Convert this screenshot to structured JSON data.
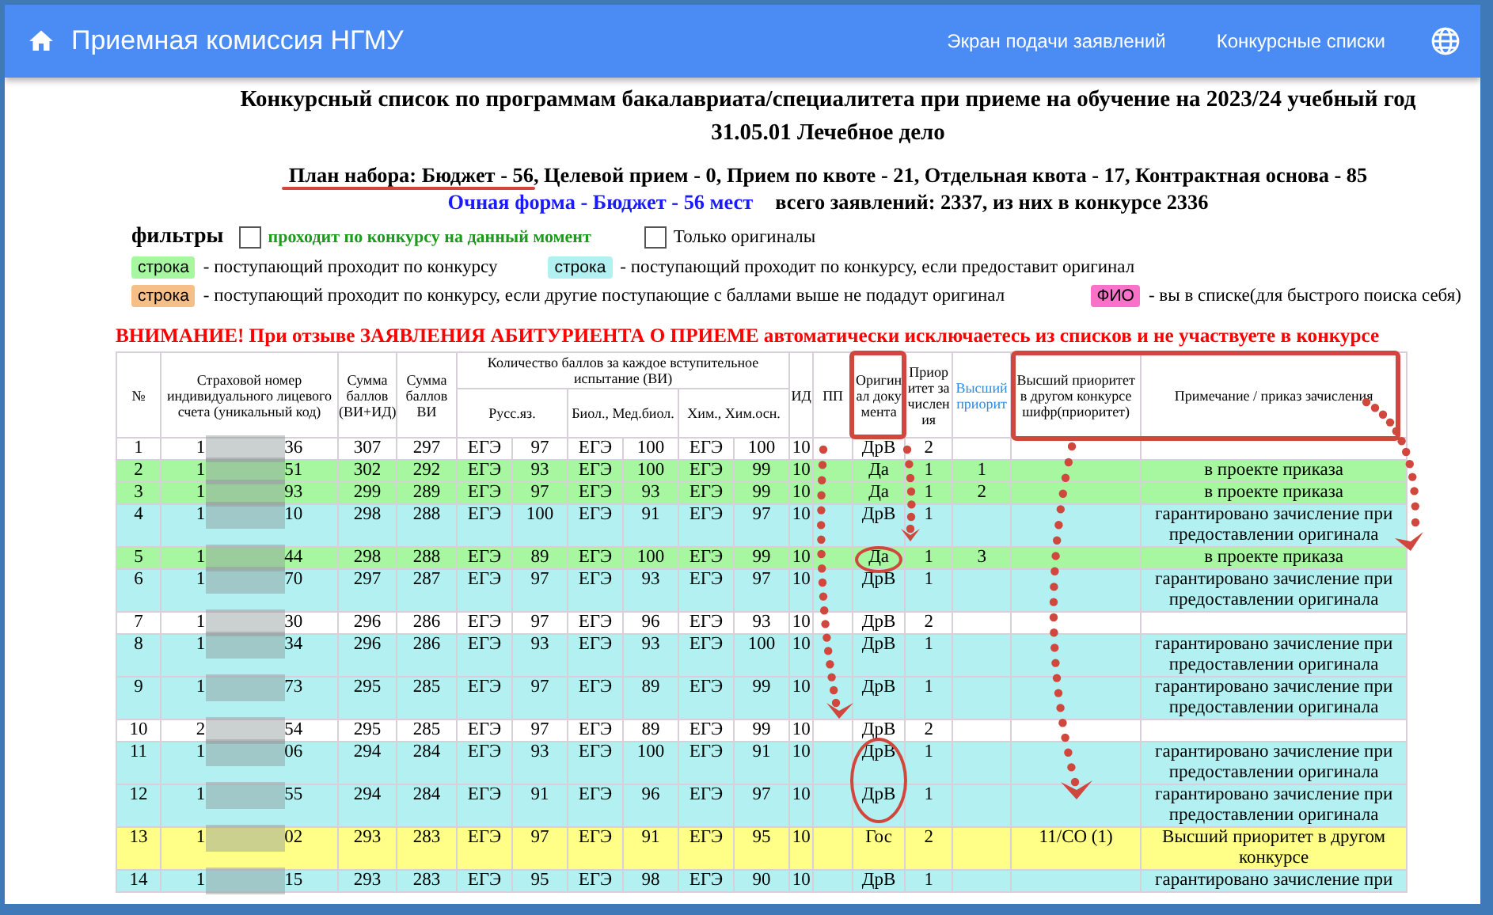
{
  "app_bar": {
    "title": "Приемная комиссия НГМУ",
    "links": [
      "Экран подачи заявлений",
      "Конкурсные списки"
    ]
  },
  "heading": {
    "title": "Конкурсный список по программам бакалавриата/специалитета при приеме на обучение на 2023/24 учебный год",
    "program": "31.05.01 Лечебное дело",
    "plan": "План набора: Бюджет - 56, Целевой прием - 0, Прием по квоте - 21, Отдельная квота - 17, Контрактная основа - 85",
    "form": "Очная форма - Бюджет - 56 мест",
    "totals": "всего заявлений:  2337, из них в конкурсе 2336"
  },
  "filters": {
    "label": "фильтры",
    "options": [
      {
        "label": "проходит по конкурсу на данный момент",
        "checked": false,
        "kind": "highlight"
      },
      {
        "label": "Только оригиналы",
        "checked": false,
        "kind": "plain"
      }
    ]
  },
  "legend": [
    [
      {
        "swatch": "строка",
        "color": "#a6f7a0",
        "text": "- поступающий проходит по конкурсу"
      },
      {
        "swatch": "строка",
        "color": "#b2f0f2",
        "text": "- поступающий проходит по конкурсу, если предоставит оригинал"
      }
    ],
    [
      {
        "swatch": "строка",
        "color": "#f7bf88",
        "text": "- поступающий проходит по конкурсу, если другие поступающие с баллами выше не подадут оригинал"
      },
      {
        "swatch": "ФИО",
        "color": "#f772c8",
        "text": "- вы в списке(для быстрого поиска себя)"
      }
    ]
  ],
  "warning": "ВНИМАНИЕ! При отзыве ЗАЯВЛЕНИЯ АБИТУРИЕНТА О ПРИЕМЕ автоматически исключаетесь из списков и не участвуете в конкурсе",
  "table": {
    "columns": {
      "no": "№",
      "snils": "Страховой номер индивидуального лицевого счета (уникальный код)",
      "sum_total": "Сумма баллов (ВИ+ИД)",
      "sum_vi": "Сумма баллов ВИ",
      "exams": "Количество баллов за каждое вступительное испытание (ВИ)",
      "subjects": [
        "Русс.яз.",
        "Биол., Мед.биол.",
        "Хим., Хим.осн."
      ],
      "id_points": "ИД",
      "pp": "ПП",
      "original": "Оригинал документа",
      "priority": "Приоритет зачисления",
      "top_priority": "Высший приорит",
      "other_contest": "Высший приоритет в другом конкурсе шифр(приоритет)",
      "note": "Примечание / приказ зачисления"
    },
    "rows": [
      {
        "no": "1",
        "snils_start": "1",
        "snils_end": "36",
        "sum_total": "307",
        "sum_vi": "297",
        "scores": [
          {
            "type": "ЕГЭ",
            "score": "97"
          },
          {
            "type": "ЕГЭ",
            "score": "100"
          },
          {
            "type": "ЕГЭ",
            "score": "100"
          }
        ],
        "id_points": "10",
        "original": "ДрВ",
        "priority": "2",
        "color": "#ffffff"
      },
      {
        "no": "2",
        "snils_start": "1",
        "snils_end": "51",
        "sum_total": "302",
        "sum_vi": "292",
        "scores": [
          {
            "type": "ЕГЭ",
            "score": "93"
          },
          {
            "type": "ЕГЭ",
            "score": "100"
          },
          {
            "type": "ЕГЭ",
            "score": "99"
          }
        ],
        "id_points": "10",
        "original": "Да",
        "priority": "1",
        "top_priority": "1",
        "note": "в проекте приказа",
        "color": "#a6f7a0"
      },
      {
        "no": "3",
        "snils_start": "1",
        "snils_end": "93",
        "sum_total": "299",
        "sum_vi": "289",
        "scores": [
          {
            "type": "ЕГЭ",
            "score": "97"
          },
          {
            "type": "ЕГЭ",
            "score": "93"
          },
          {
            "type": "ЕГЭ",
            "score": "99"
          }
        ],
        "id_points": "10",
        "original": "Да",
        "priority": "1",
        "top_priority": "2",
        "note": "в проекте приказа",
        "color": "#a6f7a0"
      },
      {
        "no": "4",
        "snils_start": "1",
        "snils_end": "10",
        "sum_total": "298",
        "sum_vi": "288",
        "scores": [
          {
            "type": "ЕГЭ",
            "score": "100"
          },
          {
            "type": "ЕГЭ",
            "score": "91"
          },
          {
            "type": "ЕГЭ",
            "score": "97"
          }
        ],
        "id_points": "10",
        "original": "ДрВ",
        "priority": "1",
        "note": "гарантировано зачисление при предоставлении оригинала",
        "color": "#b2f0f2"
      },
      {
        "no": "5",
        "snils_start": "1",
        "snils_end": "44",
        "sum_total": "298",
        "sum_vi": "288",
        "scores": [
          {
            "type": "ЕГЭ",
            "score": "89"
          },
          {
            "type": "ЕГЭ",
            "score": "100"
          },
          {
            "type": "ЕГЭ",
            "score": "99"
          }
        ],
        "id_points": "10",
        "original": "Да",
        "circled": true,
        "priority": "1",
        "top_priority": "3",
        "note": "в проекте приказа",
        "color": "#a6f7a0"
      },
      {
        "no": "6",
        "snils_start": "1",
        "snils_end": "70",
        "sum_total": "297",
        "sum_vi": "287",
        "scores": [
          {
            "type": "ЕГЭ",
            "score": "97"
          },
          {
            "type": "ЕГЭ",
            "score": "93"
          },
          {
            "type": "ЕГЭ",
            "score": "97"
          }
        ],
        "id_points": "10",
        "original": "ДрВ",
        "priority": "1",
        "note": "гарантировано зачисление при предоставлении оригинала",
        "color": "#b2f0f2"
      },
      {
        "no": "7",
        "snils_start": "1",
        "snils_end": "30",
        "sum_total": "296",
        "sum_vi": "286",
        "scores": [
          {
            "type": "ЕГЭ",
            "score": "97"
          },
          {
            "type": "ЕГЭ",
            "score": "96"
          },
          {
            "type": "ЕГЭ",
            "score": "93"
          }
        ],
        "id_points": "10",
        "original": "ДрВ",
        "priority": "2",
        "color": "#ffffff"
      },
      {
        "no": "8",
        "snils_start": "1",
        "snils_end": "34",
        "sum_total": "296",
        "sum_vi": "286",
        "scores": [
          {
            "type": "ЕГЭ",
            "score": "93"
          },
          {
            "type": "ЕГЭ",
            "score": "93"
          },
          {
            "type": "ЕГЭ",
            "score": "100"
          }
        ],
        "id_points": "10",
        "original": "ДрВ",
        "priority": "1",
        "note": "гарантировано зачисление при предоставлении оригинала",
        "color": "#b2f0f2"
      },
      {
        "no": "9",
        "snils_start": "1",
        "snils_end": "73",
        "sum_total": "295",
        "sum_vi": "285",
        "scores": [
          {
            "type": "ЕГЭ",
            "score": "97"
          },
          {
            "type": "ЕГЭ",
            "score": "89"
          },
          {
            "type": "ЕГЭ",
            "score": "99"
          }
        ],
        "id_points": "10",
        "original": "ДрВ",
        "priority": "1",
        "note": "гарантировано зачисление при предоставлении оригинала",
        "color": "#b2f0f2"
      },
      {
        "no": "10",
        "snils_start": "2",
        "snils_end": "54",
        "sum_total": "295",
        "sum_vi": "285",
        "scores": [
          {
            "type": "ЕГЭ",
            "score": "97"
          },
          {
            "type": "ЕГЭ",
            "score": "89"
          },
          {
            "type": "ЕГЭ",
            "score": "99"
          }
        ],
        "id_points": "10",
        "original": "ДрВ",
        "priority": "2",
        "color": "#ffffff"
      },
      {
        "no": "11",
        "snils_start": "1",
        "snils_end": "06",
        "sum_total": "294",
        "sum_vi": "284",
        "scores": [
          {
            "type": "ЕГЭ",
            "score": "93"
          },
          {
            "type": "ЕГЭ",
            "score": "100"
          },
          {
            "type": "ЕГЭ",
            "score": "91"
          }
        ],
        "id_points": "10",
        "original": "ДрВ",
        "circled": true,
        "priority": "1",
        "note": "гарантировано зачисление при предоставлении оригинала",
        "color": "#b2f0f2"
      },
      {
        "no": "12",
        "snils_start": "1",
        "snils_end": "55",
        "sum_total": "294",
        "sum_vi": "284",
        "scores": [
          {
            "type": "ЕГЭ",
            "score": "91"
          },
          {
            "type": "ЕГЭ",
            "score": "96"
          },
          {
            "type": "ЕГЭ",
            "score": "97"
          }
        ],
        "id_points": "10",
        "original": "ДрВ",
        "circled": true,
        "priority": "1",
        "note": "гарантировано зачисление при предоставлении оригинала",
        "color": "#b2f0f2"
      },
      {
        "no": "13",
        "snils_start": "1",
        "snils_end": "02",
        "sum_total": "293",
        "sum_vi": "283",
        "scores": [
          {
            "type": "ЕГЭ",
            "score": "97"
          },
          {
            "type": "ЕГЭ",
            "score": "91"
          },
          {
            "type": "ЕГЭ",
            "score": "95"
          }
        ],
        "id_points": "10",
        "original": "Гос",
        "priority": "2",
        "other_contest": "11/СО (1)",
        "note": "Высший приоритет в другом конкурсе",
        "color": "#ffff88"
      },
      {
        "no": "14",
        "snils_start": "1",
        "snils_end": "15",
        "sum_total": "293",
        "sum_vi": "283",
        "scores": [
          {
            "type": "ЕГЭ",
            "score": "95"
          },
          {
            "type": "ЕГЭ",
            "score": "98"
          },
          {
            "type": "ЕГЭ",
            "score": "90"
          }
        ],
        "id_points": "10",
        "original": "ДрВ",
        "priority": "1",
        "note": "гарантировано зачисление при",
        "color": "#b2f0f2"
      }
    ]
  }
}
